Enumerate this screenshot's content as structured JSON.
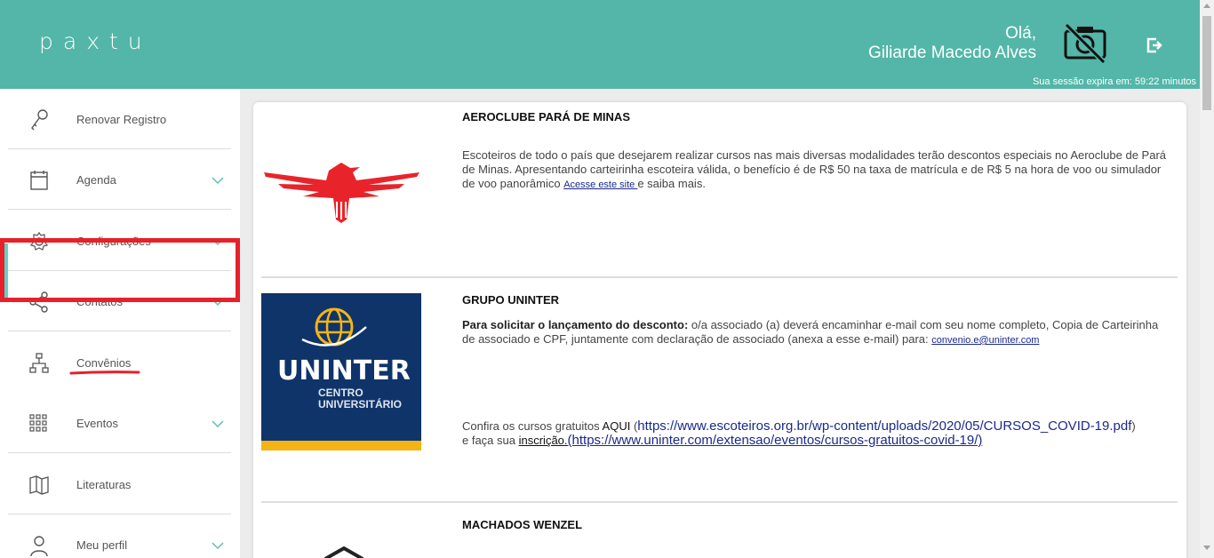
{
  "header": {
    "logo": "paxtu",
    "greeting": "Olá,",
    "user_name": "Giliarde Macedo Alves",
    "session": "Sua sessão expira em: 59:22 minutos"
  },
  "sidebar": {
    "items": [
      {
        "label": "Renovar  Registro",
        "icon": "key-icon",
        "chevron": false
      },
      {
        "label": "Agenda",
        "icon": "calendar-icon",
        "chevron": true
      },
      {
        "label": "Configurações",
        "icon": "gear-icon",
        "chevron": true
      },
      {
        "label": "Contatos",
        "icon": "share-icon",
        "chevron": true
      },
      {
        "label": "Convênios",
        "icon": "sitemap-icon",
        "chevron": false,
        "active": true
      },
      {
        "label": "Eventos",
        "icon": "grid-icon",
        "chevron": true
      },
      {
        "label": "Literaturas",
        "icon": "book-icon",
        "chevron": false
      },
      {
        "label": "Meu perfil",
        "icon": "user-icon",
        "chevron": true
      }
    ]
  },
  "entries": [
    {
      "title": "AEROCLUBE PARÁ DE MINAS",
      "text": "Escoteiros de todo o país que desejarem realizar cursos nas mais diversas modalidades terão descontos especiais no Aeroclube de Pará de Minas. Apresentando carteirinha escoteira válida, o benefício é de R$ 50 na taxa de matrícula e de R$ 5 na hora de voo ou simulador de voo panorâmico ",
      "link": "Acesse este site ",
      "text_after": "e saiba mais."
    },
    {
      "title": "GRUPO UNINTER",
      "bold_lead": "Para solicitar o lançamento do desconto:",
      "text": " o/a associado (a) deverá encaminhar e-mail com seu nome completo, Copia de Carteirinha de associado e CPF, juntamente com declaração de associado (anexa a esse e-mail) para: ",
      "email": "convenio.e@uninter.com",
      "courses_prefix": "Confira os cursos gratuitos ",
      "courses_aqui": "AQUI",
      "courses_open": " (",
      "courses_url": "https://www.escoteiros.org.br/wp-content/uploads/2020/05/CURSOS_COVID-19.pdf",
      "courses_close": ")",
      "signup_prefix": "e faça sua ",
      "signup_word": "inscrição.",
      "signup_url": "(https://www.uninter.com/extensao/eventos/cursos-gratuitos-covid-19/)",
      "logo_main": "UNINTER",
      "logo_sub1": "CENTRO",
      "logo_sub2": "UNIVERSITÁRIO"
    },
    {
      "title": "MACHADOS WENZEL"
    }
  ],
  "colors": {
    "header": "#53b6a8",
    "active_bar": "#5fd3c7",
    "highlight": "#e8202a",
    "uninter_blue": "#0f3469",
    "uninter_yellow": "#f5b415",
    "eagle_red": "#e8242a"
  }
}
